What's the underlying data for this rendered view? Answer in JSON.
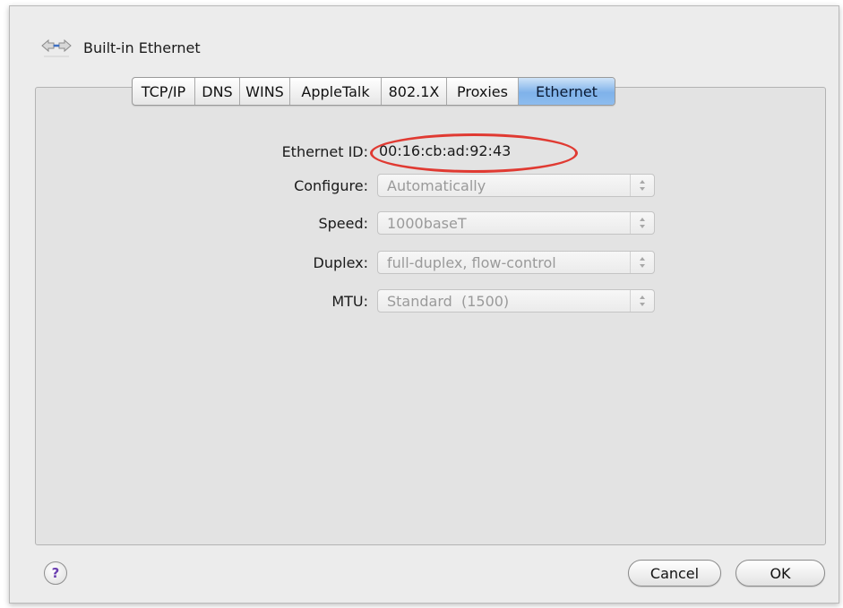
{
  "header": {
    "title": "Built-in Ethernet",
    "icon": "network-arrows-icon"
  },
  "tabs": [
    {
      "label": "TCP/IP"
    },
    {
      "label": "DNS"
    },
    {
      "label": "WINS"
    },
    {
      "label": "AppleTalk"
    },
    {
      "label": "802.1X"
    },
    {
      "label": "Proxies"
    },
    {
      "label": "Ethernet",
      "active": true
    }
  ],
  "form": {
    "ethernet_id_label": "Ethernet ID:",
    "ethernet_id_value": "00:16:cb:ad:92:43",
    "configure_label": "Configure:",
    "configure_value": "Automatically",
    "speed_label": "Speed:",
    "speed_value": "1000baseT",
    "duplex_label": "Duplex:",
    "duplex_value": "full-duplex, flow-control",
    "mtu_label": "MTU:",
    "mtu_value": "Standard  (1500)"
  },
  "buttons": {
    "help": "?",
    "cancel": "Cancel",
    "ok": "OK"
  },
  "colors": {
    "highlight_oval": "#e03a32",
    "active_tab": "#7fb2ea"
  }
}
